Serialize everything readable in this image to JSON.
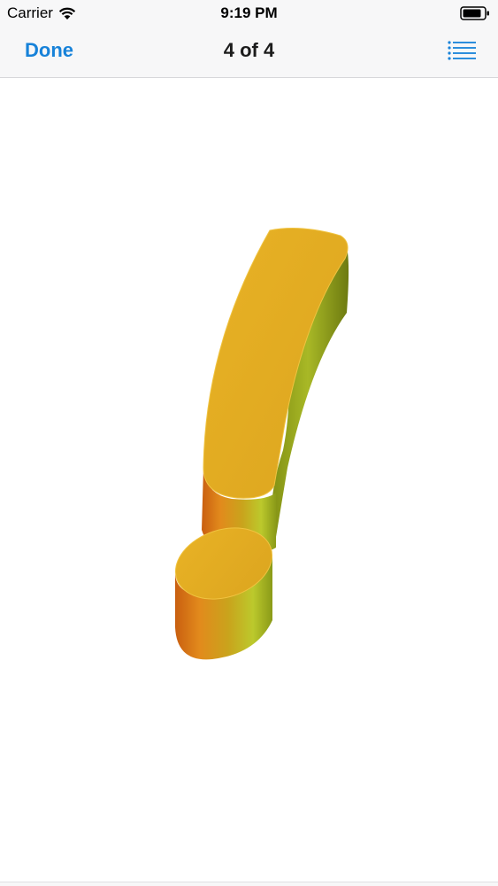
{
  "status_bar": {
    "carrier": "Carrier",
    "time": "9:19 PM",
    "wifi_icon": "wifi-icon",
    "battery_icon": "battery-icon"
  },
  "nav_bar": {
    "done_label": "Done",
    "title": "4 of 4",
    "list_icon": "list-icon",
    "accent_color": "#1782d9"
  },
  "content": {
    "image": "3d-exclamation-mark",
    "image_color": "#e2ae22"
  }
}
